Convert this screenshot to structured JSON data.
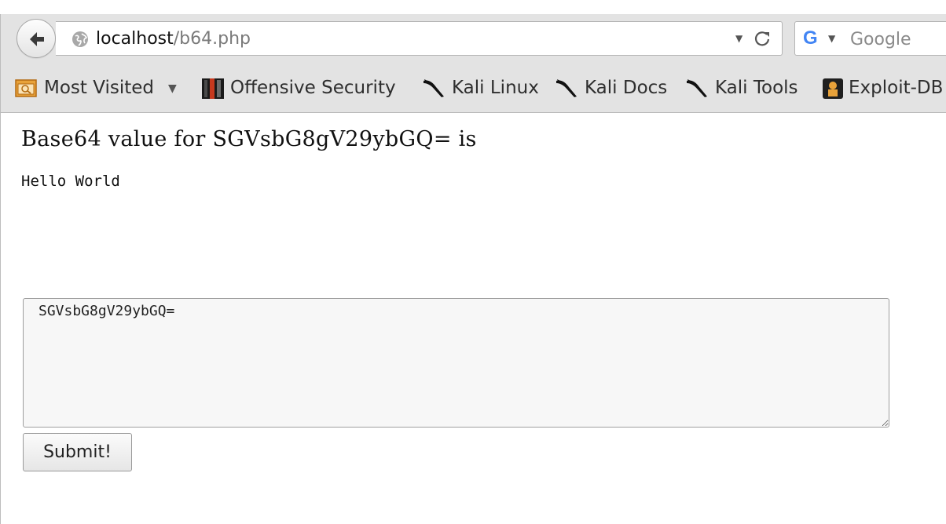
{
  "browser": {
    "url_host": "localhost",
    "url_path": "/b64.php",
    "search_engine": "Google",
    "search_placeholder": "Google",
    "bookmarks": [
      {
        "label": "Most Visited",
        "icon": "folder-icon",
        "has_dropdown": true
      },
      {
        "label": "Offensive Security",
        "icon": "offsec-icon"
      },
      {
        "label": "Kali Linux",
        "icon": "kali-dragon-icon"
      },
      {
        "label": "Kali Docs",
        "icon": "kali-dragon-icon"
      },
      {
        "label": "Kali Tools",
        "icon": "kali-dragon-icon"
      },
      {
        "label": "Exploit-DB",
        "icon": "exploit-db-icon"
      }
    ]
  },
  "page": {
    "heading": "Base64 value for SGVsbG8gV29ybGQ= is",
    "decoded_output": "Hello World",
    "input_value": "SGVsbG8gV29ybGQ=",
    "submit_label": "Submit!"
  }
}
